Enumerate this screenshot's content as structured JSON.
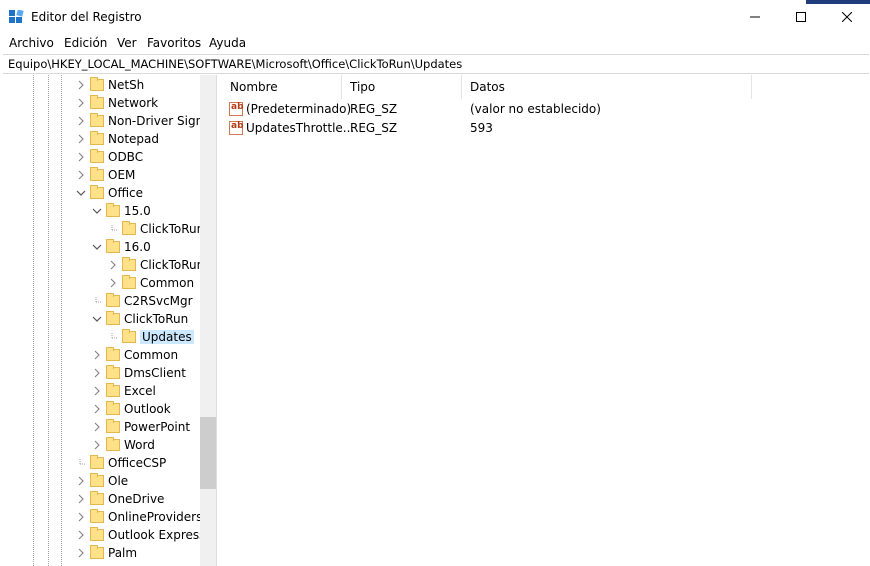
{
  "window": {
    "title": "Editor del Registro"
  },
  "menu": [
    "Archivo",
    "Edición",
    "Ver",
    "Favoritos",
    "Ayuda"
  ],
  "address": "Equipo\\HKEY_LOCAL_MACHINE\\SOFTWARE\\Microsoft\\Office\\ClickToRun\\Updates",
  "tree": [
    {
      "label": "NetSh",
      "depth": 0,
      "state": "collapsed"
    },
    {
      "label": "Network",
      "depth": 0,
      "state": "collapsed"
    },
    {
      "label": "Non-Driver Signin",
      "depth": 0,
      "state": "collapsed"
    },
    {
      "label": "Notepad",
      "depth": 0,
      "state": "collapsed"
    },
    {
      "label": "ODBC",
      "depth": 0,
      "state": "collapsed"
    },
    {
      "label": "OEM",
      "depth": 0,
      "state": "collapsed"
    },
    {
      "label": "Office",
      "depth": 0,
      "state": "expanded"
    },
    {
      "label": "15.0",
      "depth": 1,
      "state": "expanded"
    },
    {
      "label": "ClickToRun",
      "depth": 2,
      "state": "leaf"
    },
    {
      "label": "16.0",
      "depth": 1,
      "state": "expanded"
    },
    {
      "label": "ClickToRun",
      "depth": 2,
      "state": "collapsed"
    },
    {
      "label": "Common",
      "depth": 2,
      "state": "collapsed"
    },
    {
      "label": "C2RSvcMgr",
      "depth": 1,
      "state": "leaf"
    },
    {
      "label": "ClickToRun",
      "depth": 1,
      "state": "expanded"
    },
    {
      "label": "Updates",
      "depth": 2,
      "state": "leaf",
      "selected": true
    },
    {
      "label": "Common",
      "depth": 1,
      "state": "collapsed"
    },
    {
      "label": "DmsClient",
      "depth": 1,
      "state": "collapsed"
    },
    {
      "label": "Excel",
      "depth": 1,
      "state": "collapsed"
    },
    {
      "label": "Outlook",
      "depth": 1,
      "state": "collapsed"
    },
    {
      "label": "PowerPoint",
      "depth": 1,
      "state": "collapsed"
    },
    {
      "label": "Word",
      "depth": 1,
      "state": "collapsed"
    },
    {
      "label": "OfficeCSP",
      "depth": 0,
      "state": "leaf"
    },
    {
      "label": "Ole",
      "depth": 0,
      "state": "collapsed"
    },
    {
      "label": "OneDrive",
      "depth": 0,
      "state": "collapsed"
    },
    {
      "label": "OnlineProviders",
      "depth": 0,
      "state": "collapsed"
    },
    {
      "label": "Outlook Express",
      "depth": 0,
      "state": "collapsed"
    },
    {
      "label": "Palm",
      "depth": 0,
      "state": "collapsed"
    }
  ],
  "columns": [
    "Nombre",
    "Tipo",
    "Datos"
  ],
  "values": [
    {
      "name": "(Predeterminado)",
      "type": "REG_SZ",
      "data": "(valor no establecido)",
      "icon": "string-value-icon"
    },
    {
      "name": "UpdatesThrottle...",
      "type": "REG_SZ",
      "data": "593",
      "icon": "string-value-icon"
    }
  ],
  "colors": {
    "selection": "#cce8ff",
    "folder": "#ffe18a",
    "accent": "#1f3d7a"
  }
}
